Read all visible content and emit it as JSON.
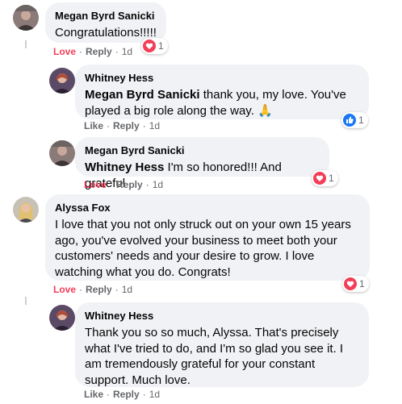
{
  "comments": [
    {
      "author": "Megan Byrd Sanicki",
      "text": "Congratulations!!!!!",
      "actions": {
        "first": "Love",
        "reply": "Reply",
        "time": "1d"
      },
      "reaction": {
        "icon": "heart-reaction-icon",
        "count": "1"
      }
    },
    {
      "author": "Whitney Hess",
      "mention": "Megan Byrd Sanicki",
      "text": " thank you, my love. You've played a big role along the way. 🙏",
      "actions": {
        "first": "Like",
        "reply": "Reply",
        "time": "1d"
      },
      "reaction": {
        "icon": "like-reaction-icon",
        "count": "1"
      }
    },
    {
      "author": "Megan Byrd Sanicki",
      "mention": "Whitney Hess",
      "text": " I'm so honored!!! And grateful",
      "actions": {
        "first": "Love",
        "reply": "Reply",
        "time": "1d"
      },
      "reaction": {
        "icon": "heart-reaction-icon",
        "count": "1"
      }
    },
    {
      "author": "Alyssa Fox",
      "text": "I love that you not only struck out on your own 15 years ago, you've evolved your business to meet both your customers' needs and your desire to grow. I love watching what you do. Congrats!",
      "actions": {
        "first": "Love",
        "reply": "Reply",
        "time": "1d"
      },
      "reaction": {
        "icon": "heart-reaction-icon",
        "count": "1"
      }
    },
    {
      "author": "Whitney Hess",
      "text": "Thank you so so much, Alyssa. That's precisely what I've tried to do, and I'm so glad you see it. I am tremendously grateful for your constant support. Much love.",
      "actions": {
        "first": "Like",
        "reply": "Reply",
        "time": "1d"
      }
    }
  ],
  "colors": {
    "bubble": "#f0f2f5",
    "love": "#f33e58",
    "like": "#1877f2",
    "meta": "#65676b"
  }
}
